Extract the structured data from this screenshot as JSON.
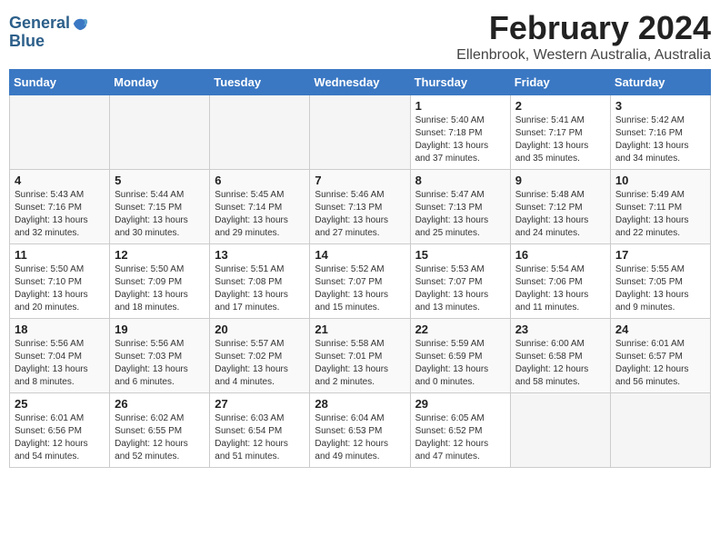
{
  "logo": {
    "line1": "General",
    "line2": "Blue"
  },
  "title": "February 2024",
  "subtitle": "Ellenbrook, Western Australia, Australia",
  "days_header": [
    "Sunday",
    "Monday",
    "Tuesday",
    "Wednesday",
    "Thursday",
    "Friday",
    "Saturday"
  ],
  "weeks": [
    [
      {
        "num": "",
        "detail": ""
      },
      {
        "num": "",
        "detail": ""
      },
      {
        "num": "",
        "detail": ""
      },
      {
        "num": "",
        "detail": ""
      },
      {
        "num": "1",
        "detail": "Sunrise: 5:40 AM\nSunset: 7:18 PM\nDaylight: 13 hours\nand 37 minutes."
      },
      {
        "num": "2",
        "detail": "Sunrise: 5:41 AM\nSunset: 7:17 PM\nDaylight: 13 hours\nand 35 minutes."
      },
      {
        "num": "3",
        "detail": "Sunrise: 5:42 AM\nSunset: 7:16 PM\nDaylight: 13 hours\nand 34 minutes."
      }
    ],
    [
      {
        "num": "4",
        "detail": "Sunrise: 5:43 AM\nSunset: 7:16 PM\nDaylight: 13 hours\nand 32 minutes."
      },
      {
        "num": "5",
        "detail": "Sunrise: 5:44 AM\nSunset: 7:15 PM\nDaylight: 13 hours\nand 30 minutes."
      },
      {
        "num": "6",
        "detail": "Sunrise: 5:45 AM\nSunset: 7:14 PM\nDaylight: 13 hours\nand 29 minutes."
      },
      {
        "num": "7",
        "detail": "Sunrise: 5:46 AM\nSunset: 7:13 PM\nDaylight: 13 hours\nand 27 minutes."
      },
      {
        "num": "8",
        "detail": "Sunrise: 5:47 AM\nSunset: 7:13 PM\nDaylight: 13 hours\nand 25 minutes."
      },
      {
        "num": "9",
        "detail": "Sunrise: 5:48 AM\nSunset: 7:12 PM\nDaylight: 13 hours\nand 24 minutes."
      },
      {
        "num": "10",
        "detail": "Sunrise: 5:49 AM\nSunset: 7:11 PM\nDaylight: 13 hours\nand 22 minutes."
      }
    ],
    [
      {
        "num": "11",
        "detail": "Sunrise: 5:50 AM\nSunset: 7:10 PM\nDaylight: 13 hours\nand 20 minutes."
      },
      {
        "num": "12",
        "detail": "Sunrise: 5:50 AM\nSunset: 7:09 PM\nDaylight: 13 hours\nand 18 minutes."
      },
      {
        "num": "13",
        "detail": "Sunrise: 5:51 AM\nSunset: 7:08 PM\nDaylight: 13 hours\nand 17 minutes."
      },
      {
        "num": "14",
        "detail": "Sunrise: 5:52 AM\nSunset: 7:07 PM\nDaylight: 13 hours\nand 15 minutes."
      },
      {
        "num": "15",
        "detail": "Sunrise: 5:53 AM\nSunset: 7:07 PM\nDaylight: 13 hours\nand 13 minutes."
      },
      {
        "num": "16",
        "detail": "Sunrise: 5:54 AM\nSunset: 7:06 PM\nDaylight: 13 hours\nand 11 minutes."
      },
      {
        "num": "17",
        "detail": "Sunrise: 5:55 AM\nSunset: 7:05 PM\nDaylight: 13 hours\nand 9 minutes."
      }
    ],
    [
      {
        "num": "18",
        "detail": "Sunrise: 5:56 AM\nSunset: 7:04 PM\nDaylight: 13 hours\nand 8 minutes."
      },
      {
        "num": "19",
        "detail": "Sunrise: 5:56 AM\nSunset: 7:03 PM\nDaylight: 13 hours\nand 6 minutes."
      },
      {
        "num": "20",
        "detail": "Sunrise: 5:57 AM\nSunset: 7:02 PM\nDaylight: 13 hours\nand 4 minutes."
      },
      {
        "num": "21",
        "detail": "Sunrise: 5:58 AM\nSunset: 7:01 PM\nDaylight: 13 hours\nand 2 minutes."
      },
      {
        "num": "22",
        "detail": "Sunrise: 5:59 AM\nSunset: 6:59 PM\nDaylight: 13 hours\nand 0 minutes."
      },
      {
        "num": "23",
        "detail": "Sunrise: 6:00 AM\nSunset: 6:58 PM\nDaylight: 12 hours\nand 58 minutes."
      },
      {
        "num": "24",
        "detail": "Sunrise: 6:01 AM\nSunset: 6:57 PM\nDaylight: 12 hours\nand 56 minutes."
      }
    ],
    [
      {
        "num": "25",
        "detail": "Sunrise: 6:01 AM\nSunset: 6:56 PM\nDaylight: 12 hours\nand 54 minutes."
      },
      {
        "num": "26",
        "detail": "Sunrise: 6:02 AM\nSunset: 6:55 PM\nDaylight: 12 hours\nand 52 minutes."
      },
      {
        "num": "27",
        "detail": "Sunrise: 6:03 AM\nSunset: 6:54 PM\nDaylight: 12 hours\nand 51 minutes."
      },
      {
        "num": "28",
        "detail": "Sunrise: 6:04 AM\nSunset: 6:53 PM\nDaylight: 12 hours\nand 49 minutes."
      },
      {
        "num": "29",
        "detail": "Sunrise: 6:05 AM\nSunset: 6:52 PM\nDaylight: 12 hours\nand 47 minutes."
      },
      {
        "num": "",
        "detail": ""
      },
      {
        "num": "",
        "detail": ""
      }
    ]
  ]
}
